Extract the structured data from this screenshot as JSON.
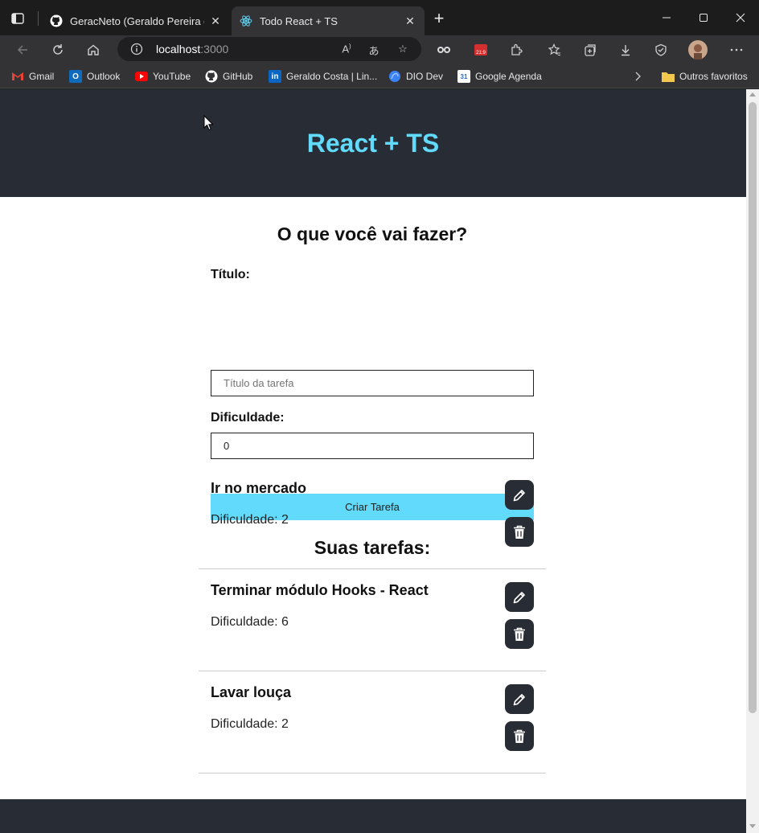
{
  "browser": {
    "tabs": [
      {
        "title": "GeracNeto (Geraldo Pereira da C",
        "favicon": "github-icon",
        "active": false
      },
      {
        "title": "Todo React + TS",
        "favicon": "react-icon",
        "active": true
      }
    ],
    "address": {
      "host": "localhost",
      "port": ":3000"
    },
    "bookmarks": [
      {
        "label": "Gmail",
        "icon": "gmail-icon"
      },
      {
        "label": "Outlook",
        "icon": "outlook-icon"
      },
      {
        "label": "YouTube",
        "icon": "youtube-icon"
      },
      {
        "label": "GitHub",
        "icon": "github-icon"
      },
      {
        "label": "Geraldo Costa | Lin...",
        "icon": "linkedin-icon"
      },
      {
        "label": "DIO Dev",
        "icon": "dio-icon"
      },
      {
        "label": "Google Agenda",
        "icon": "calendar-icon"
      }
    ],
    "other_favorites": "Outros favoritos"
  },
  "app": {
    "header_title": "React + TS",
    "form": {
      "heading": "O que você vai fazer?",
      "title_label": "Título:",
      "title_placeholder": "Título da tarefa",
      "difficulty_label": "Dificuldade:",
      "difficulty_value": "0",
      "submit_label": "Criar Tarefa"
    },
    "list_heading": "Suas tarefas:",
    "tasks": [
      {
        "title": "Ir no mercado",
        "difficulty": "Dificuldade: 2"
      },
      {
        "title": "Terminar módulo Hooks - React",
        "difficulty": "Dificuldade: 6"
      },
      {
        "title": "Lavar louça",
        "difficulty": "Dificuldade: 2"
      }
    ]
  },
  "colors": {
    "accent": "#61dafb",
    "header_bg": "#282c34",
    "chrome_bg": "#333336",
    "tabbar_bg": "#1c1c1c"
  }
}
